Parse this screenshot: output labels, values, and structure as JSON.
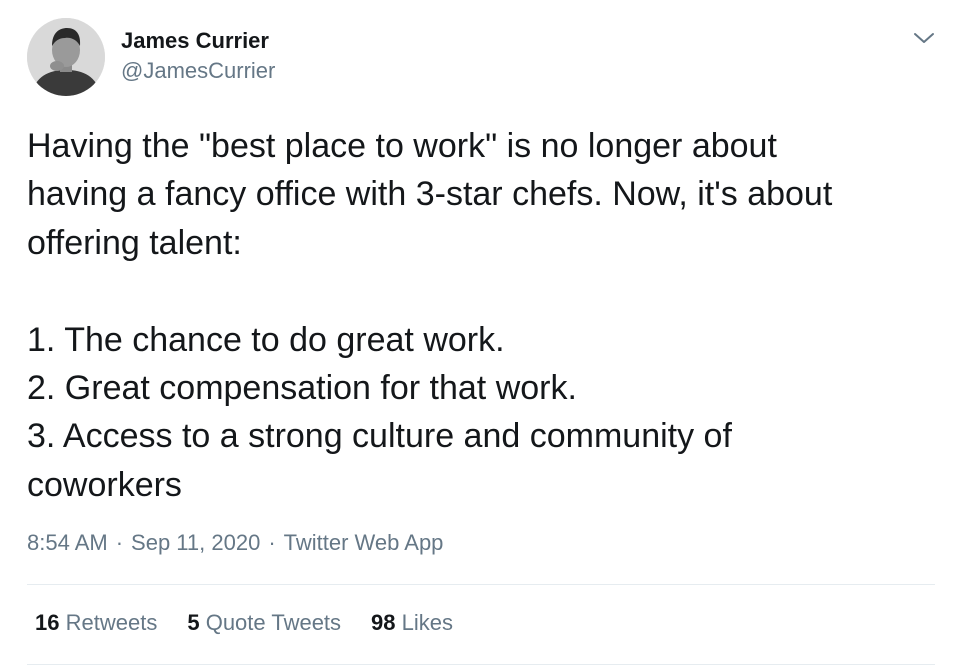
{
  "author": {
    "name": "James Currier",
    "handle": "@JamesCurrier"
  },
  "icons": {
    "avatar": "profile-photo",
    "menu": "chevron-down-icon"
  },
  "tweet": {
    "lines": [
      "Having the \"best place to work\" is no longer about",
      "having a fancy office with 3-star chefs. Now, it's about",
      "offering talent:",
      "",
      "1. The chance to do great work.",
      "2. Great compensation for that work.",
      "3. Access to a strong culture and community of",
      "coworkers"
    ]
  },
  "meta": {
    "time": "8:54 AM",
    "separator": "·",
    "date": "Sep 11, 2020",
    "source": "Twitter Web App"
  },
  "stats": {
    "retweets": {
      "count": "16",
      "label": "Retweets"
    },
    "quote_tweets": {
      "count": "5",
      "label": "Quote Tweets"
    },
    "likes": {
      "count": "98",
      "label": "Likes"
    }
  },
  "colors": {
    "text_primary": "#14171a",
    "text_secondary": "#657786",
    "divider": "#e6ecf0",
    "background": "#ffffff"
  }
}
